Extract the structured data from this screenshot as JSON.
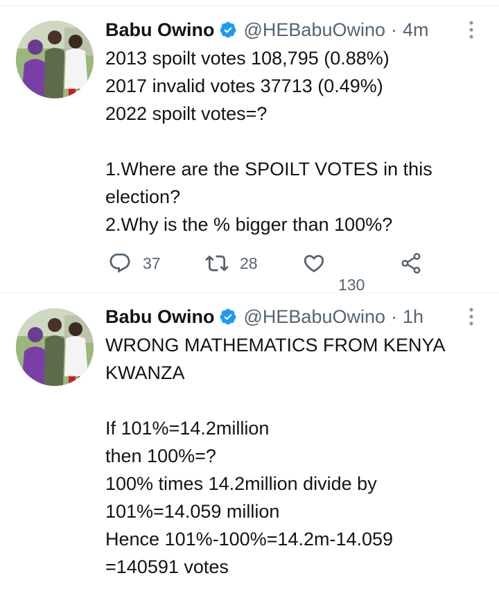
{
  "tweets": [
    {
      "author": {
        "name": "Babu Owino",
        "handle": "@HEBabuOwino",
        "verified": true
      },
      "separator": "·",
      "time": "4m",
      "lines": [
        "2013 spoilt votes 108,795 (0.88%)",
        "2017 invalid votes 37713 (0.49%)",
        "2022 spoilt votes=?",
        "",
        "1.Where are the SPOILT VOTES in this",
        "election?",
        "2.Why is the % bigger than 100%?"
      ],
      "stats": {
        "replies": "37",
        "retweets": "28",
        "likes": "130"
      }
    },
    {
      "author": {
        "name": "Babu Owino",
        "handle": "@HEBabuOwino",
        "verified": true
      },
      "separator": "·",
      "time": "1h",
      "lines": [
        "WRONG MATHEMATICS FROM KENYA",
        "KWANZA",
        "",
        "If 101%=14.2million",
        "then 100%=?",
        "100% times 14.2million divide by",
        "101%=14.059 million",
        "Hence 101%-100%=14.2m-14.059",
        "=140591 votes"
      ]
    }
  ],
  "colors": {
    "text_primary": "#0f1419",
    "text_secondary": "#536471",
    "verified_blue": "#1d9bf0",
    "divider": "#eff3f4"
  },
  "icons": {
    "reply": "speech-bubble-icon",
    "retweet": "retweet-arrows-icon",
    "like": "heart-outline-icon",
    "share": "share-nodes-icon",
    "more": "vertical-ellipsis-icon",
    "verified": "verified-badge-icon"
  }
}
